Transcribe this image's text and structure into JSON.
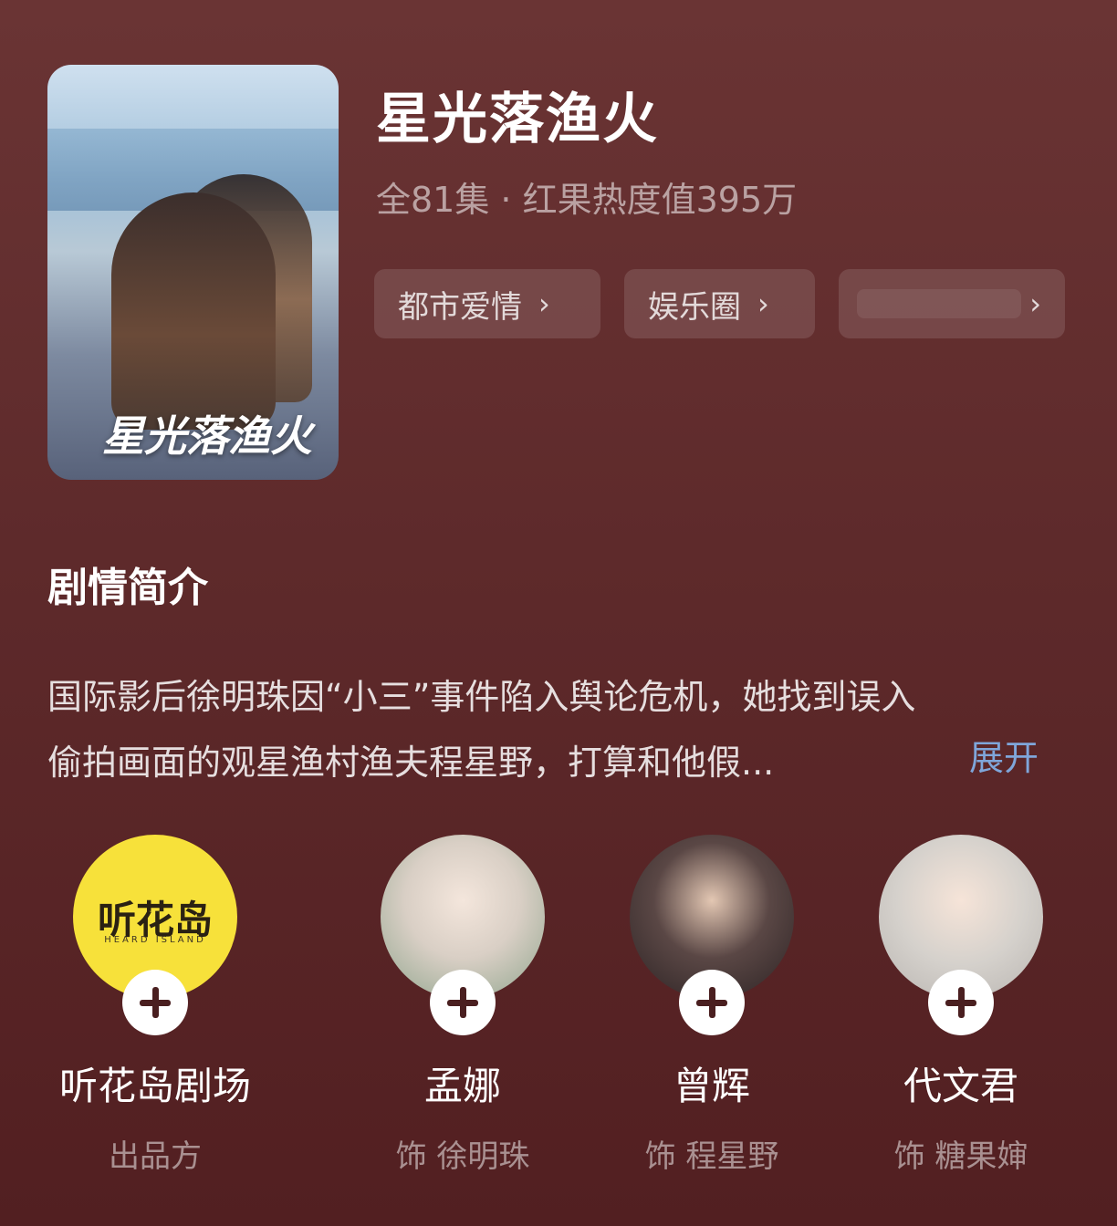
{
  "drama": {
    "title": "星光落渔火",
    "meta": "全81集 · 红果热度值395万",
    "poster_title": "星光落渔火"
  },
  "tags": [
    {
      "label": "都市爱情",
      "chevron": "›"
    },
    {
      "label": "娱乐圈",
      "chevron": "›"
    },
    {
      "label": "",
      "chevron": "›"
    }
  ],
  "synopsis": {
    "title": "剧情简介",
    "line1": "国际影后徐明珠因“小三”事件陷入舆论危机，她找到误入",
    "line2": "偷拍画面的观星渔村渔夫程星野，打算和他假...",
    "expand_label": "展开"
  },
  "people": [
    {
      "name": "听花岛剧场",
      "role": "出品方",
      "logo_text": "听花岛",
      "logo_sub": "HEARD ISLAND"
    },
    {
      "name": "孟娜",
      "role": "饰 徐明珠"
    },
    {
      "name": "曾辉",
      "role": "饰 程星野"
    },
    {
      "name": "代文君",
      "role": "饰 糖果婶"
    }
  ],
  "colors": {
    "background": "#5e2a2b",
    "expand_link": "#7fa6da",
    "logo_yellow": "#f7e13a"
  }
}
